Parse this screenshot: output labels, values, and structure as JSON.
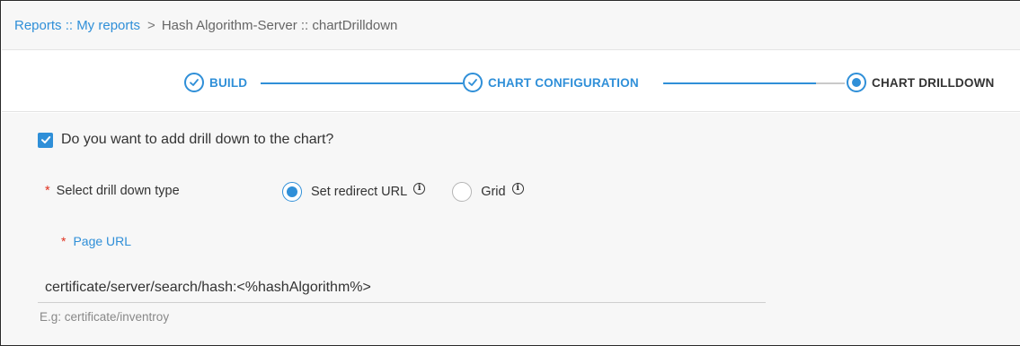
{
  "breadcrumb": {
    "root": "Reports :: My reports",
    "separator": ">",
    "current": "Hash Algorithm-Server :: chartDrilldown"
  },
  "stepper": {
    "steps": [
      {
        "label": "BUILD",
        "state": "done",
        "icon": "check-circle-icon"
      },
      {
        "label": "CHART CONFIGURATION",
        "state": "done",
        "icon": "check-circle-icon"
      },
      {
        "label": "CHART DRILLDOWN",
        "state": "active",
        "icon": "radio-dot-icon"
      }
    ]
  },
  "form": {
    "drilldown_checkbox": {
      "label": "Do you want to add drill down to the chart?",
      "checked": true
    },
    "drilldown_type": {
      "label": "Select drill down type",
      "required_mark": "*",
      "options": [
        {
          "label": "Set redirect URL",
          "selected": true,
          "info_icon": "info-icon"
        },
        {
          "label": "Grid",
          "selected": false,
          "info_icon": "info-icon"
        }
      ]
    },
    "page_url": {
      "label": "Page URL",
      "required_mark": "*",
      "value": "certificate/server/search/hash:<%hashAlgorithm%>",
      "hint": "E.g: certificate/inventroy"
    }
  },
  "colors": {
    "accent": "#2f8fd8",
    "required": "#e0301e",
    "panel_bg": "#f7f7f7"
  }
}
